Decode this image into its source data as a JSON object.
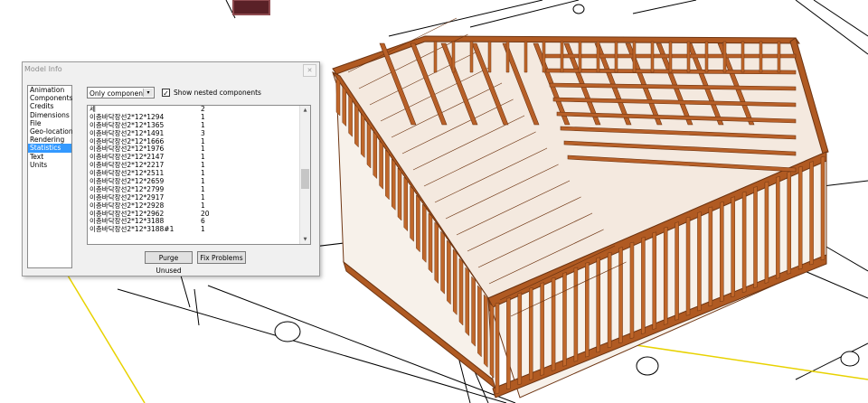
{
  "window": {
    "title": "Model Info",
    "close_glyph": "✕",
    "close_icon": "close-icon"
  },
  "categories": [
    {
      "label": "Animation"
    },
    {
      "label": "Components"
    },
    {
      "label": "Credits"
    },
    {
      "label": "Dimensions"
    },
    {
      "label": "File"
    },
    {
      "label": "Geo-location"
    },
    {
      "label": "Rendering"
    },
    {
      "label": "Statistics",
      "selected": true
    },
    {
      "label": "Text"
    },
    {
      "label": "Units"
    }
  ],
  "statistics": {
    "filter_value": "Only components",
    "filter_arrow": "▾",
    "show_nested_checked": true,
    "show_nested_mark": "✓",
    "show_nested_label": "Show nested components",
    "rows": [
      {
        "name": "세",
        "count": "2"
      },
      {
        "name": "이층바닥장선2*12*1294",
        "count": "1"
      },
      {
        "name": "이층바닥장선2*12*1365",
        "count": "1"
      },
      {
        "name": "이층바닥장선2*12*1491",
        "count": "3"
      },
      {
        "name": "이층바닥장선2*12*1666",
        "count": "1"
      },
      {
        "name": "이층바닥장선2*12*1976",
        "count": "1"
      },
      {
        "name": "이층바닥장선2*12*2147",
        "count": "1"
      },
      {
        "name": "이층바닥장선2*12*2217",
        "count": "1"
      },
      {
        "name": "이층바닥장선2*12*2511",
        "count": "1"
      },
      {
        "name": "이층바닥장선2*12*2659",
        "count": "1"
      },
      {
        "name": "이층바닥장선2*12*2799",
        "count": "1"
      },
      {
        "name": "이층바닥장선2*12*2917",
        "count": "1"
      },
      {
        "name": "이층바닥장선2*12*2928",
        "count": "1"
      },
      {
        "name": "이층바닥장선2*12*2962",
        "count": "20"
      },
      {
        "name": "이층바닥장선2*12*3188",
        "count": "6"
      },
      {
        "name": "이층바닥장선2*12*3188#1",
        "count": "1"
      }
    ],
    "scroll_up_glyph": "▲",
    "scroll_down_glyph": "▼",
    "purge_label": "Purge Unused",
    "fix_label": "Fix Problems"
  },
  "scene": {
    "wood_color": "#b05a22",
    "wood_dark": "#6e3512",
    "wood_light": "#d07a3a",
    "line_color": "#000000"
  }
}
